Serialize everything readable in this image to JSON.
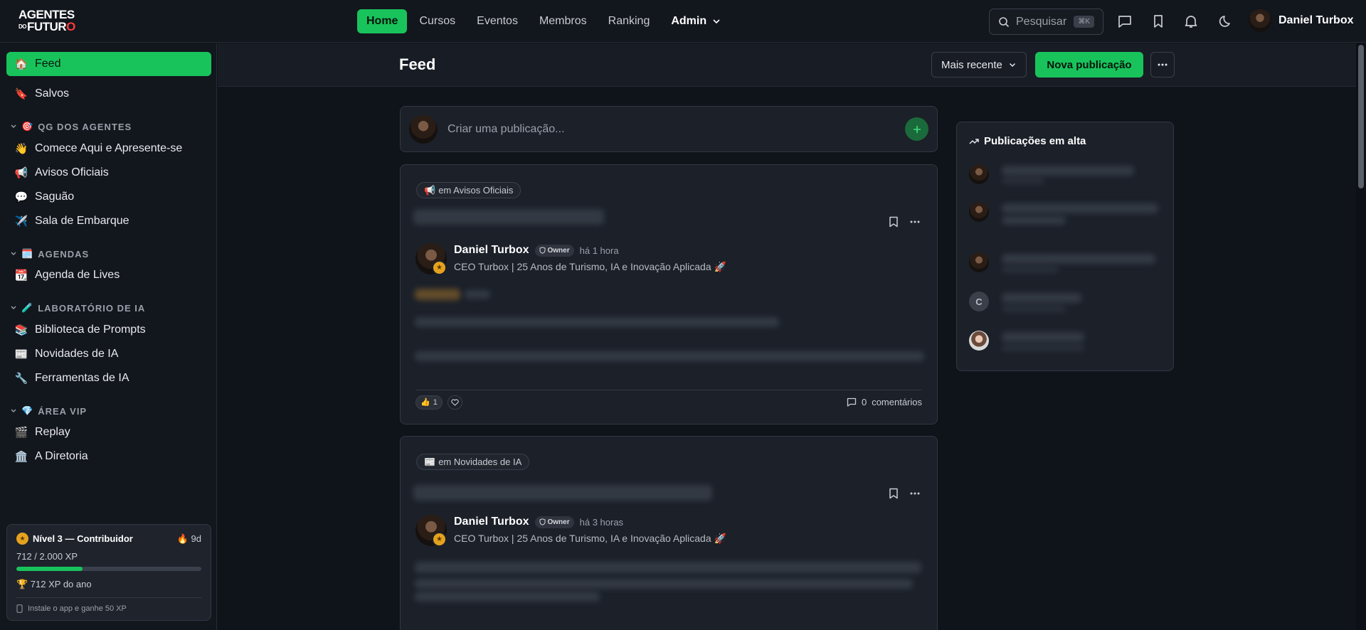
{
  "logo": {
    "line1": "AGENTES",
    "line2_small": "DO",
    "line2": "FUTUR",
    "line2_o": "O"
  },
  "nav": {
    "items": [
      "Home",
      "Cursos",
      "Eventos",
      "Membros",
      "Ranking"
    ],
    "admin": "Admin",
    "active": "Home"
  },
  "search": {
    "placeholder": "Pesquisar",
    "shortcut": "⌘K"
  },
  "user": {
    "name": "Daniel Turbox"
  },
  "sidebar": {
    "top_items": [
      {
        "emoji": "🏠",
        "label": "Feed",
        "active": true
      },
      {
        "emoji": "🔖",
        "label": "Salvos"
      }
    ],
    "sections": [
      {
        "emoji": "🎯",
        "title": "QG DOS AGENTES",
        "items": [
          {
            "emoji": "👋",
            "label": "Comece Aqui e Apresente-se"
          },
          {
            "emoji": "📢",
            "label": "Avisos Oficiais"
          },
          {
            "emoji": "💬",
            "label": "Saguão"
          },
          {
            "emoji": "✈️",
            "label": "Sala de Embarque"
          }
        ]
      },
      {
        "emoji": "🗓️",
        "title": "AGENDAS",
        "items": [
          {
            "emoji": "📆",
            "label": "Agenda de Lives"
          }
        ]
      },
      {
        "emoji": "🧪",
        "title": "LABORATÓRIO DE IA",
        "items": [
          {
            "emoji": "📚",
            "label": "Biblioteca de Prompts"
          },
          {
            "emoji": "📰",
            "label": "Novidades de IA"
          },
          {
            "emoji": "🔧",
            "label": "Ferramentas de IA"
          }
        ]
      },
      {
        "emoji": "💎",
        "title": "ÁREA VIP",
        "items": [
          {
            "emoji": "🎬",
            "label": "Replay"
          },
          {
            "emoji": "🏛️",
            "label": "A Diretoria"
          }
        ]
      }
    ]
  },
  "xp": {
    "level": "Nível 3 — Contribuidor",
    "streak": "🔥 9d",
    "progress_text": "712 / 2.000 XP",
    "progress_fraction": 0.356,
    "year": "🏆 712 XP do ano",
    "install": "Instale o app e ganhe 50 XP"
  },
  "header": {
    "title": "Feed",
    "sort": "Mais recente",
    "new_post": "Nova publicação"
  },
  "composer": {
    "placeholder": "Criar uma publicação..."
  },
  "posts": [
    {
      "space_emoji": "📢",
      "space": "em Avisos Oficiais",
      "author": "Daniel Turbox",
      "badge": "Owner",
      "time": "há 1 hora",
      "headline": "CEO Turbox | 25 Anos de Turismo, IA e Inovação Aplicada 🚀",
      "reaction": "👍",
      "reaction_count": "1",
      "comment_count": "0",
      "comment_label": "comentários"
    },
    {
      "space_emoji": "📰",
      "space": "em Novidades de IA",
      "author": "Daniel Turbox",
      "badge": "Owner",
      "time": "há 3 horas",
      "headline": "CEO Turbox | 25 Anos de Turismo, IA e Inovação Aplicada 🚀"
    }
  ],
  "trending": {
    "title": "Publicações em alta",
    "c_avatar_letter": "C"
  },
  "colors": {
    "accent": "#19c35c",
    "bg": "#0f131a",
    "card": "#1b2029"
  }
}
